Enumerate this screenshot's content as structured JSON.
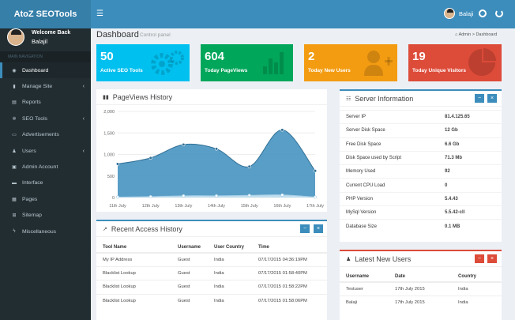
{
  "app": {
    "logo": "AtoZ SEOTools",
    "toggle_icon": "hamburger-icon"
  },
  "topbar": {
    "username": "Balaji"
  },
  "sidebar": {
    "welcome": "Welcome Back",
    "username": "Balajil",
    "nav_label": "MAIN NAVIGATION",
    "items": [
      {
        "label": "Dashboard",
        "icon": "dashboard-icon",
        "active": true
      },
      {
        "label": "Manage Site",
        "icon": "bar-chart-icon",
        "chev": "‹"
      },
      {
        "label": "Reports",
        "icon": "file-icon"
      },
      {
        "label": "SEO Tools",
        "icon": "cogs-icon",
        "chev": "‹"
      },
      {
        "label": "Advertisements",
        "icon": "money-icon"
      },
      {
        "label": "Users",
        "icon": "users-icon",
        "chev": "‹"
      },
      {
        "label": "Admin Account",
        "icon": "user-icon"
      },
      {
        "label": "Interface",
        "icon": "desktop-icon"
      },
      {
        "label": "Pages",
        "icon": "pages-icon"
      },
      {
        "label": "Sitemap",
        "icon": "sitemap-icon"
      },
      {
        "label": "Miscellaneous",
        "icon": "bolt-icon"
      }
    ]
  },
  "header": {
    "title": "Dashboard",
    "subtitle": "Control panel",
    "crumb_1": "Admin",
    "crumb_sep": ">",
    "crumb_2": "Dashboard"
  },
  "stats": [
    {
      "value": "50",
      "label": "Active SEO Tools",
      "color": "#00c0ef",
      "icon": "gears-icon"
    },
    {
      "value": "604",
      "label": "Today PageViews",
      "color": "#00a65a",
      "icon": "bar-chart-icon"
    },
    {
      "value": "2",
      "label": "Today New Users",
      "color": "#f39c12",
      "icon": "user-plus-icon"
    },
    {
      "value": "19",
      "label": "Today Unique Visitors",
      "color": "#dd4b39",
      "icon": "pie-chart-icon"
    }
  ],
  "pageviews": {
    "title": "PageViews History",
    "icon": "bar-chart-icon"
  },
  "chart_data": {
    "type": "area",
    "title": "PageViews History",
    "categories": [
      "11th July",
      "12th July",
      "13th July",
      "14th July",
      "15th July",
      "16th July",
      "17th July"
    ],
    "yticks": [
      "2,000",
      "1,500",
      "1,000",
      "500",
      "0"
    ],
    "ylim": [
      0,
      2000
    ],
    "series": [
      {
        "values": [
          780,
          920,
          1230,
          1130,
          720,
          1570,
          620
        ],
        "color": "#3c8dbc"
      },
      {
        "values": [
          10,
          20,
          40,
          40,
          50,
          60,
          10
        ],
        "color": "#cce4f2"
      }
    ],
    "grid": true
  },
  "server": {
    "title": "Server Information",
    "rows": [
      {
        "k": "Server IP",
        "v": "81.4.125.65"
      },
      {
        "k": "Server Disk Space",
        "v": "12 Gb"
      },
      {
        "k": "Free Disk Space",
        "v": "6.6 Gb"
      },
      {
        "k": "Disk Space used by Script",
        "v": "71.3 Mb"
      },
      {
        "k": "Memory Used",
        "v": "92"
      },
      {
        "k": "Current CPU Load",
        "v": "0"
      },
      {
        "k": "PHP Version",
        "v": "5.4.43"
      },
      {
        "k": "MySql Version",
        "v": "5.5.42-cll"
      },
      {
        "k": "Database Size",
        "v": "0.1 MB"
      }
    ],
    "btn_min": "−",
    "btn_close": "×"
  },
  "recent": {
    "title": "Recent Access History",
    "headers": [
      "Tool Name",
      "Username",
      "User Country",
      "Time"
    ],
    "rows": [
      {
        "tool": "My IP Address",
        "user": "Guest",
        "country": "India",
        "time": "07/17/2015 04:36:19PM",
        "link": true
      },
      {
        "tool": "Blacklist Lookup",
        "user": "Guest",
        "country": "India",
        "time": "07/17/2015 01:58:40PM",
        "link": false
      },
      {
        "tool": "Blacklist Lookup",
        "user": "Guest",
        "country": "India",
        "time": "07/17/2015 01:58:22PM",
        "link": true
      },
      {
        "tool": "Blacklist Lookup",
        "user": "Guest",
        "country": "India",
        "time": "07/17/2015 01:58:06PM",
        "link": true
      }
    ],
    "btn_min": "−",
    "btn_close": "×"
  },
  "newusers": {
    "title": "Latest New Users",
    "headers": [
      "Username",
      "Date",
      "Country"
    ],
    "rows": [
      {
        "user": "Testuser",
        "date": "17th July 2015",
        "country": "India"
      },
      {
        "user": "Balaji",
        "date": "17th July 2015",
        "country": "India"
      }
    ],
    "btn_min": "−",
    "btn_close": "×"
  }
}
